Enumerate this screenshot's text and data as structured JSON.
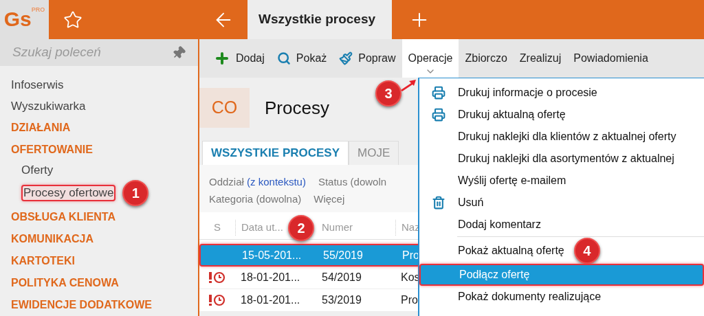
{
  "app": {
    "logo": "Gs",
    "logo_badge": "PRO"
  },
  "tabs": [
    {
      "label": "Wszystkie procesy",
      "selected": true
    }
  ],
  "sidebar": {
    "search": {
      "placeholder": "Szukaj poleceń"
    },
    "items": [
      {
        "kind": "link",
        "label": "Infoserwis",
        "highlighted": false
      },
      {
        "kind": "link",
        "label": "Wyszukiwarka",
        "highlighted": false
      },
      {
        "kind": "section",
        "label": "DZIAŁANIA",
        "highlighted": false
      },
      {
        "kind": "section",
        "label": "OFERTOWANIE",
        "highlighted": false
      },
      {
        "kind": "subitem",
        "label": "Oferty",
        "highlighted": false
      },
      {
        "kind": "subitem",
        "label": "Procesy ofertowe",
        "highlighted": true,
        "callout": "1"
      },
      {
        "kind": "section",
        "label": "OBSŁUGA KLIENTA",
        "highlighted": false
      },
      {
        "kind": "section",
        "label": "KOMUNIKACJA",
        "highlighted": false
      },
      {
        "kind": "section",
        "label": "KARTOTEKI",
        "highlighted": false
      },
      {
        "kind": "section",
        "label": "POLITYKA CENOWA",
        "highlighted": false
      },
      {
        "kind": "section",
        "label": "EWIDENCJE DODATKOWE",
        "highlighted": false
      }
    ]
  },
  "toolbar": [
    {
      "label": "Dodaj",
      "selected": false
    },
    {
      "label": "Pokaż",
      "selected": false
    },
    {
      "label": "Popraw",
      "selected": false
    },
    {
      "label": "Operacje",
      "selected": true,
      "callout": "3"
    },
    {
      "label": "Zbiorczo",
      "selected": false
    },
    {
      "label": "Zrealizuj",
      "selected": false
    },
    {
      "label": "Powiadomienia",
      "selected": false
    }
  ],
  "page": {
    "badge": "CO",
    "title": "Procesy"
  },
  "view_tabs": [
    {
      "label": "WSZYSTKIE PROCESY",
      "selected": true
    },
    {
      "label": "MOJE",
      "selected": false
    }
  ],
  "filters": [
    [
      {
        "label": "Oddział",
        "value": "(z kontekstu)"
      },
      {
        "label": "Status (dowoln"
      }
    ],
    [
      {
        "label": "Kategoria (dowolna)"
      },
      {
        "label": "Więcej"
      }
    ]
  ],
  "table": {
    "callout": "2",
    "columns": [
      "S",
      "Data ut...",
      "Numer",
      "Naz"
    ],
    "rows": [
      {
        "alert": false,
        "selected": true,
        "highlighted": true,
        "cells": [
          "",
          "15-05-201...",
          "55/2019",
          "Pro"
        ]
      },
      {
        "alert": true,
        "selected": false,
        "highlighted": false,
        "cells": [
          "",
          "18-01-201...",
          "54/2019",
          "Kos"
        ]
      },
      {
        "alert": true,
        "selected": false,
        "highlighted": false,
        "cells": [
          "",
          "18-01-201...",
          "53/2019",
          "Pro"
        ]
      }
    ]
  },
  "menu": [
    {
      "label": "Drukuj informacje o procesie",
      "separator_before": false,
      "selected": false,
      "highlighted": false
    },
    {
      "label": "Drukuj aktualną ofertę",
      "separator_before": false,
      "selected": false,
      "highlighted": false
    },
    {
      "label": "Drukuj naklejki dla klientów z aktualnej oferty",
      "separator_before": false,
      "selected": false,
      "highlighted": false
    },
    {
      "label": "Drukuj naklejki dla asortymentów z aktualnej",
      "separator_before": false,
      "selected": false,
      "highlighted": false
    },
    {
      "label": "Wyślij ofertę e-mailem",
      "separator_before": false,
      "selected": false,
      "highlighted": false
    },
    {
      "label": "Usuń",
      "separator_before": false,
      "selected": false,
      "highlighted": false
    },
    {
      "label": "Dodaj komentarz",
      "separator_before": false,
      "selected": false,
      "highlighted": false
    },
    {
      "label": "Pokaż aktualną ofertę",
      "separator_before": true,
      "selected": false,
      "highlighted": false,
      "callout": "4"
    },
    {
      "label": "Podłącz ofertę",
      "separator_before": false,
      "selected": true,
      "highlighted": true
    },
    {
      "label": "Pokaż dokumenty realizujące",
      "separator_before": false,
      "selected": false,
      "highlighted": false
    }
  ]
}
